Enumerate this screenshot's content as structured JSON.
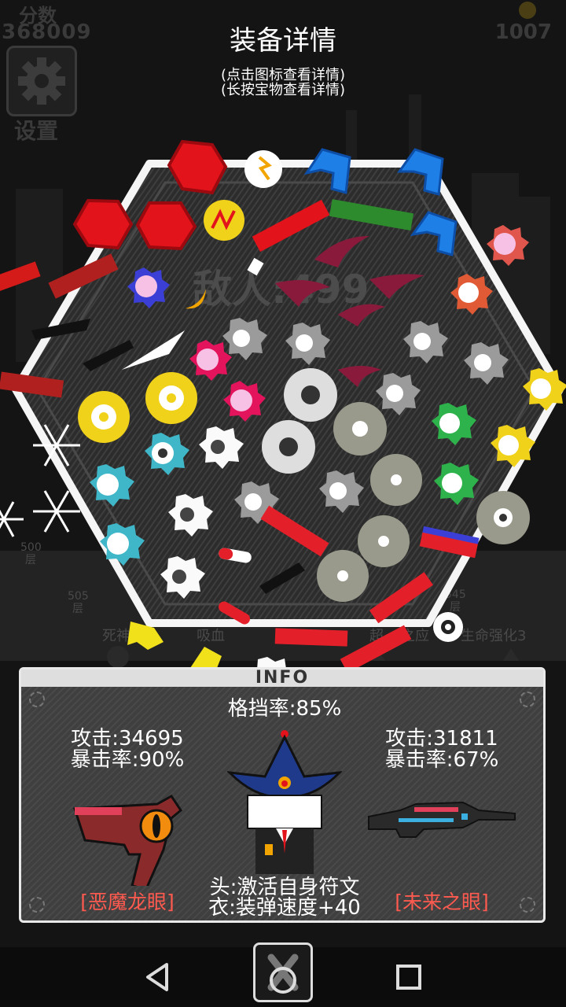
{
  "hud": {
    "score_label": "分数",
    "score_value": "368009",
    "coins_value": "1007",
    "settings_label": "设置",
    "ammo_count": "0"
  },
  "header": {
    "title": "装备详情",
    "hint_tap": "(点击图标查看详情)",
    "hint_hold": "(长按宝物查看详情)"
  },
  "background_labels": {
    "enemy_counter": "敌人:499",
    "floor_500": "500",
    "floor_505": "505",
    "floor_545": "545",
    "floor_unit": "层",
    "perk_death": "死神",
    "perk_lifesteal": "吸血",
    "perk_super": "超",
    "perk_reaction": "之应",
    "perk_life": "生命强化3"
  },
  "info_panel": {
    "header_label": "INFO",
    "block_rate": "格挡率:85%",
    "left_weapon": {
      "attack": "攻击:34695",
      "crit": "暴击率:90%",
      "name": "[恶魔龙眼]"
    },
    "right_weapon": {
      "attack": "攻击:31811",
      "crit": "暴击率:67%",
      "name": "[未来之眼]"
    },
    "head_effect": "头:激活自身符文",
    "body_effect": "衣:装弹速度+40"
  },
  "colors": {
    "accent_red": "#e8101a",
    "weapon_name": "#ff5a4f",
    "panel_bg": "#3f3f3f",
    "panel_border": "#e9e9e9"
  },
  "icons": {
    "settings": "gear-icon",
    "nav_back": "triangle-back-icon",
    "nav_home": "home-circle-icon",
    "nav_recents": "square-recents-icon",
    "close": "close-icon"
  }
}
